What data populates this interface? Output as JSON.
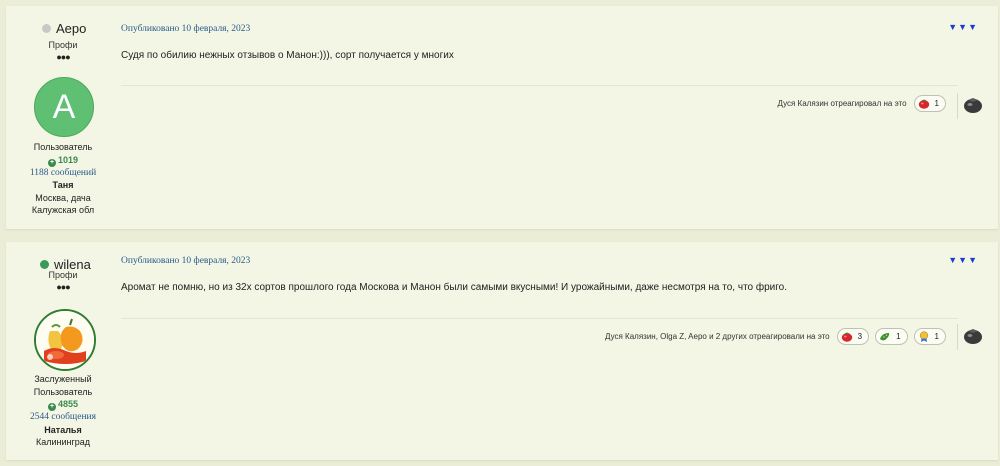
{
  "posts": [
    {
      "author": {
        "name": "Aepo",
        "status_color": "#c8c8c8",
        "rank": "Профи",
        "pips": "●●●",
        "avatar_letter": "A",
        "avatar_color": "#5fbf73",
        "group": [
          "Пользователь"
        ],
        "reputation": "1019",
        "posts_count": "1188 сообщений",
        "display_name": "Таня",
        "location": [
          "Москва, дача",
          "Калужская обл"
        ]
      },
      "date": "Опубликовано 10 февраля, 2023",
      "menu_icon": "▼▼▼",
      "content": "Судя по обилию нежных отзывов о Манон:))), сорт получается у многих",
      "reactions_text": "Дуся Калязин отреагировал на это",
      "reactions": [
        {
          "icon": "tomato-icon",
          "count": "1"
        }
      ]
    },
    {
      "author": {
        "name": "wilena",
        "status_color": "#3a9a5a",
        "rank": "Профи",
        "pips": "●●●",
        "group": [
          "Заслуженный",
          "Пользователь"
        ],
        "reputation": "4855",
        "posts_count": "2544 сообщения",
        "display_name": "Наталья",
        "location": [
          "Калининград"
        ]
      },
      "date": "Опубликовано 10 февраля, 2023",
      "menu_icon": "▼▼▼",
      "content": "Аромат не помню, но из 32х сортов прошлого года Москова и Манон были самыми вкусными! И урожайными, даже несмотря на то, что фриго.",
      "reactions_text": "Дуся Калязин, Olga Z, Aepo и 2 других отреагировали на это",
      "reactions": [
        {
          "icon": "tomato-icon",
          "count": "3"
        },
        {
          "icon": "cucumber-icon",
          "count": "1"
        },
        {
          "icon": "award-icon",
          "count": "1"
        }
      ]
    }
  ]
}
